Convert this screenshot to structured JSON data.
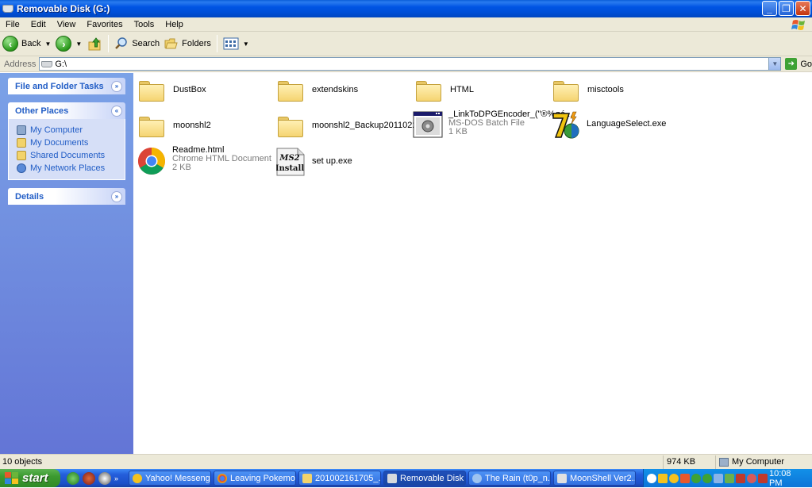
{
  "window": {
    "title": "Removable Disk (G:)"
  },
  "menu": [
    "File",
    "Edit",
    "View",
    "Favorites",
    "Tools",
    "Help"
  ],
  "toolbar": {
    "back": "Back",
    "search": "Search",
    "folders": "Folders"
  },
  "address": {
    "label": "Address",
    "value": "G:\\",
    "go": "Go"
  },
  "taskpane": {
    "file_tasks": "File and Folder Tasks",
    "other_places": {
      "title": "Other Places",
      "items": [
        "My Computer",
        "My Documents",
        "Shared Documents",
        "My Network Places"
      ]
    },
    "details": "Details"
  },
  "files": [
    {
      "name": "DustBox",
      "type": "",
      "size": "",
      "icon": "folder-icon"
    },
    {
      "name": "extendskins",
      "type": "",
      "size": "",
      "icon": "folder-icon"
    },
    {
      "name": "HTML",
      "type": "",
      "size": "",
      "icon": "folder-icon"
    },
    {
      "name": "misctools",
      "type": "",
      "size": "",
      "icon": "folder-icon"
    },
    {
      "name": "moonshl2",
      "type": "",
      "size": "",
      "icon": "folder-icon"
    },
    {
      "name": "moonshl2_Backup20110227-2...",
      "type": "",
      "size": "",
      "icon": "folder-icon"
    },
    {
      "name": "_LinkToDPGEncoder_(\"®%øé...",
      "type": "MS-DOS Batch File",
      "size": "1 KB",
      "icon": "batch-file-icon"
    },
    {
      "name": "LanguageSelect.exe",
      "type": "",
      "size": "",
      "icon": "7zip-exe-icon"
    },
    {
      "name": "Readme.html",
      "type": "Chrome HTML Document",
      "size": "2 KB",
      "icon": "chrome-document-icon"
    },
    {
      "name": "set up.exe",
      "type": "",
      "size": "",
      "icon": "ms2-install-icon",
      "icon_text_1": "MS2",
      "icon_text_2": "Install"
    }
  ],
  "status": {
    "objects": "10 objects",
    "size": "974 KB",
    "location": "My Computer"
  },
  "taskbar": {
    "start": "start",
    "tasks": [
      "Yahoo! Messenger",
      "Leaving Pokemo...",
      "201002161705_...",
      "Removable Disk ...",
      "The Rain (t0p_n...",
      "MoonShell Ver2...."
    ],
    "clock": "10:08 PM"
  },
  "colors": {
    "titlebar": "#0054e3",
    "taskpane": "#7ba2e7",
    "link": "#215dc6",
    "taskbar": "#245edb",
    "start": "#3c9a30"
  }
}
